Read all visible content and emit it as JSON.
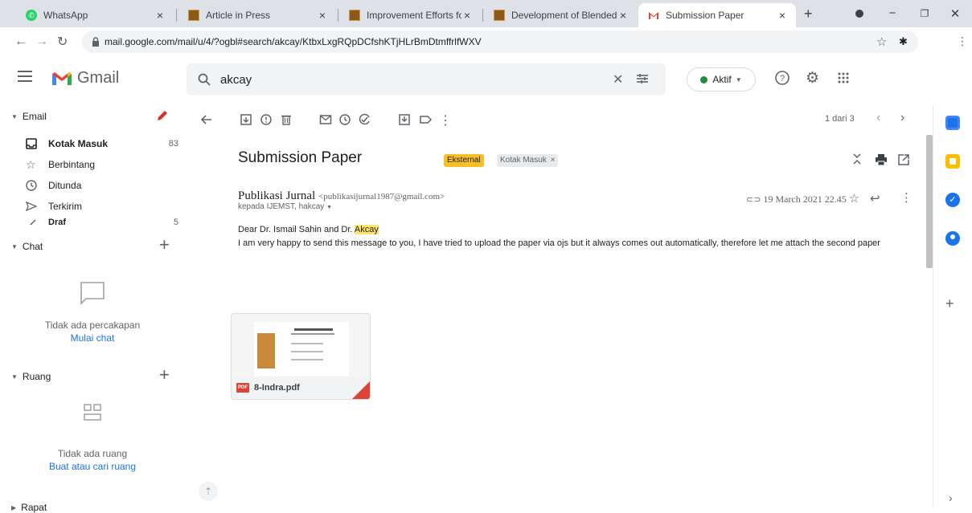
{
  "browser": {
    "tabs": [
      {
        "title": "WhatsApp",
        "icon": "whatsapp-icon"
      },
      {
        "title": "Article in Press",
        "icon": "journal-icon"
      },
      {
        "title": "Improvement Efforts for Stud",
        "icon": "journal-icon"
      },
      {
        "title": "Development of Blended Lea",
        "icon": "journal-icon"
      },
      {
        "title": "Submission Paper",
        "icon": "gmail-icon"
      }
    ],
    "url": "mail.google.com/mail/u/4/?ogbl#search/akcay/KtbxLxgRQpDCfshKTjHLrBmDtmffrlfWXV"
  },
  "gmail": {
    "app_name": "Gmail",
    "search_value": "akcay",
    "status": "Aktif",
    "status_color": "#1e8e3e"
  },
  "sidebar": {
    "email_section": "Email",
    "items": [
      {
        "label": "Kotak Masuk",
        "count": "83",
        "bold": true,
        "icon": "inbox-icon"
      },
      {
        "label": "Berbintang",
        "count": "",
        "icon": "star-icon"
      },
      {
        "label": "Ditunda",
        "count": "",
        "icon": "clock-icon"
      },
      {
        "label": "Terkirim",
        "count": "",
        "icon": "send-icon"
      },
      {
        "label": "Draf",
        "count": "5",
        "icon": "draft-icon"
      }
    ],
    "chat_section": "Chat",
    "chat_empty": "Tidak ada percakapan",
    "chat_link": "Mulai chat",
    "rooms_section": "Ruang",
    "rooms_empty": "Tidak ada ruang",
    "rooms_link": "Buat atau cari ruang",
    "meet_section": "Rapat"
  },
  "message": {
    "pagination": "1 dari 3",
    "subject": "Submission Paper",
    "labels": [
      "Eksternal",
      "Kotak Masuk"
    ],
    "sender_name": "Publikasi Jurnal",
    "sender_email": "<publikasijurnal1987@gmail.com>",
    "recipients": "kepada IJEMST, hakcay",
    "date": "19 March 2021 22.45",
    "greeting_prefix": "Dear Dr. Ismail Sahin and Dr. ",
    "greeting_highlight": "Akcay",
    "body": "I am very happy to send this message to you, I have tried to upload the paper via ojs but it always comes out automatically, therefore let me attach the second paper",
    "attachment_name": "8-Indra.pdf"
  }
}
